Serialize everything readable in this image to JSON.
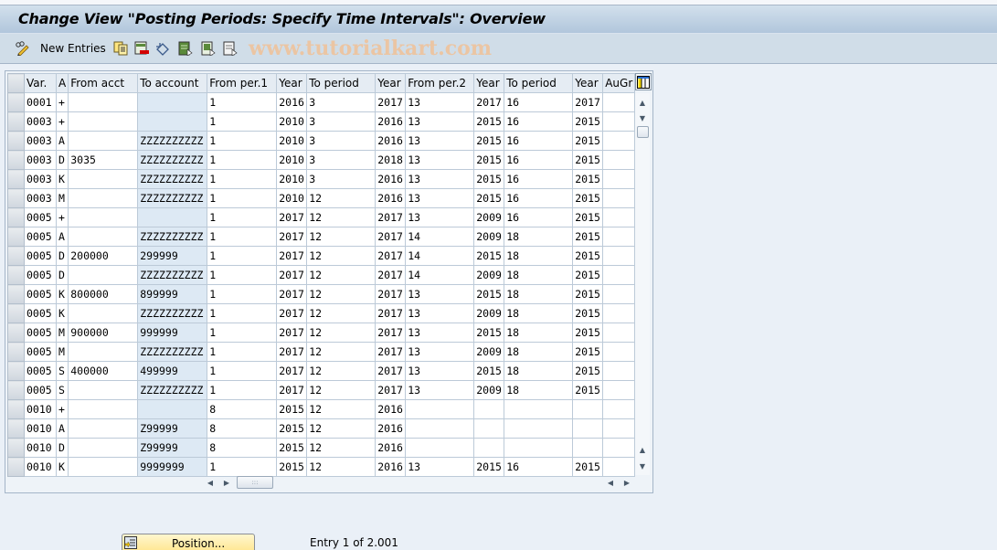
{
  "window": {
    "title": "Change View \"Posting Periods: Specify Time Intervals\": Overview"
  },
  "toolbar": {
    "items": [
      {
        "icon": "pencil-glasses-icon",
        "label": ""
      },
      {
        "icon": "new-entries",
        "label": "New Entries"
      },
      {
        "icon": "copy-icon",
        "label": ""
      },
      {
        "icon": "delete-icon",
        "label": ""
      },
      {
        "icon": "undo-icon",
        "label": ""
      },
      {
        "icon": "select-all-icon",
        "label": ""
      },
      {
        "icon": "select-block-icon",
        "label": ""
      },
      {
        "icon": "deselect-all-icon",
        "label": ""
      }
    ],
    "new_entries_label": "New Entries"
  },
  "watermark": "www.tutorialkart.com",
  "table": {
    "columns": [
      "Var.",
      "A",
      "From acct",
      "To account",
      "From per.1",
      "Year",
      "To period",
      "Year",
      "From per.2",
      "Year",
      "To period",
      "Year",
      "AuGr"
    ],
    "rows": [
      [
        "0001",
        "+",
        "",
        "",
        "1",
        "2016",
        "3",
        "2017",
        "13",
        "2017",
        "16",
        "2017",
        ""
      ],
      [
        "0003",
        "+",
        "",
        "",
        "1",
        "2010",
        "3",
        "2016",
        "13",
        "2015",
        "16",
        "2015",
        ""
      ],
      [
        "0003",
        "A",
        "",
        "ZZZZZZZZZZ",
        "1",
        "2010",
        "3",
        "2016",
        "13",
        "2015",
        "16",
        "2015",
        ""
      ],
      [
        "0003",
        "D",
        "3035",
        "ZZZZZZZZZZ",
        "1",
        "2010",
        "3",
        "2018",
        "13",
        "2015",
        "16",
        "2015",
        ""
      ],
      [
        "0003",
        "K",
        "",
        "ZZZZZZZZZZ",
        "1",
        "2010",
        "3",
        "2016",
        "13",
        "2015",
        "16",
        "2015",
        ""
      ],
      [
        "0003",
        "M",
        "",
        "ZZZZZZZZZZ",
        "1",
        "2010",
        "12",
        "2016",
        "13",
        "2015",
        "16",
        "2015",
        ""
      ],
      [
        "0005",
        "+",
        "",
        "",
        "1",
        "2017",
        "12",
        "2017",
        "13",
        "2009",
        "16",
        "2015",
        ""
      ],
      [
        "0005",
        "A",
        "",
        "ZZZZZZZZZZ",
        "1",
        "2017",
        "12",
        "2017",
        "14",
        "2009",
        "18",
        "2015",
        ""
      ],
      [
        "0005",
        "D",
        "200000",
        "299999",
        "1",
        "2017",
        "12",
        "2017",
        "14",
        "2015",
        "18",
        "2015",
        ""
      ],
      [
        "0005",
        "D",
        "",
        "ZZZZZZZZZZ",
        "1",
        "2017",
        "12",
        "2017",
        "14",
        "2009",
        "18",
        "2015",
        ""
      ],
      [
        "0005",
        "K",
        "800000",
        "899999",
        "1",
        "2017",
        "12",
        "2017",
        "13",
        "2015",
        "18",
        "2015",
        ""
      ],
      [
        "0005",
        "K",
        "",
        "ZZZZZZZZZZ",
        "1",
        "2017",
        "12",
        "2017",
        "13",
        "2009",
        "18",
        "2015",
        ""
      ],
      [
        "0005",
        "M",
        "900000",
        "999999",
        "1",
        "2017",
        "12",
        "2017",
        "13",
        "2015",
        "18",
        "2015",
        ""
      ],
      [
        "0005",
        "M",
        "",
        "ZZZZZZZZZZ",
        "1",
        "2017",
        "12",
        "2017",
        "13",
        "2009",
        "18",
        "2015",
        ""
      ],
      [
        "0005",
        "S",
        "400000",
        "499999",
        "1",
        "2017",
        "12",
        "2017",
        "13",
        "2015",
        "18",
        "2015",
        ""
      ],
      [
        "0005",
        "S",
        "",
        "ZZZZZZZZZZ",
        "1",
        "2017",
        "12",
        "2017",
        "13",
        "2009",
        "18",
        "2015",
        ""
      ],
      [
        "0010",
        "+",
        "",
        "",
        "8",
        "2015",
        "12",
        "2016",
        "",
        "",
        "",
        "",
        ""
      ],
      [
        "0010",
        "A",
        "",
        "Z99999",
        "8",
        "2015",
        "12",
        "2016",
        "",
        "",
        "",
        "",
        ""
      ],
      [
        "0010",
        "D",
        "",
        "Z99999",
        "8",
        "2015",
        "12",
        "2016",
        "",
        "",
        "",
        "",
        ""
      ],
      [
        "0010",
        "K",
        "",
        "9999999",
        "1",
        "2015",
        "12",
        "2016",
        "13",
        "2015",
        "16",
        "2015",
        ""
      ]
    ]
  },
  "footer": {
    "position_button_label": "Position...",
    "entry_info": "Entry 1 of 2.001"
  }
}
